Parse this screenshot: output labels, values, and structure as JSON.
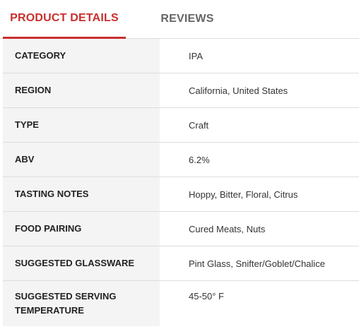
{
  "tabs": {
    "product_details": "PRODUCT DETAILS",
    "reviews": "REVIEWS"
  },
  "colors": {
    "accent": "#c8302e",
    "label_bg": "#f4f4f4",
    "divider": "#dddddd"
  },
  "details": {
    "category": {
      "label": "CATEGORY",
      "value": "IPA"
    },
    "region": {
      "label": "REGION",
      "value": "California, United States"
    },
    "type": {
      "label": "TYPE",
      "value": "Craft"
    },
    "abv": {
      "label": "ABV",
      "value": "6.2%"
    },
    "tasting_notes": {
      "label": "TASTING NOTES",
      "value": "Hoppy, Bitter, Floral, Citrus"
    },
    "food_pairing": {
      "label": "FOOD PAIRING",
      "value": "Cured Meats, Nuts"
    },
    "glassware": {
      "label": "SUGGESTED GLASSWARE",
      "value": "Pint Glass, Snifter/Goblet/Chalice"
    },
    "serving_temp": {
      "label": "SUGGESTED SERVING TEMPERATURE",
      "value": "45-50° F"
    }
  }
}
